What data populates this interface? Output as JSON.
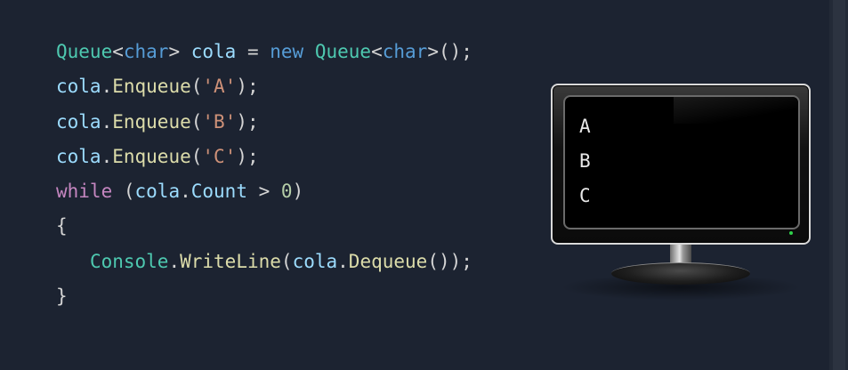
{
  "code_lines": [
    [
      {
        "text": "Queue",
        "kind": "type"
      },
      {
        "text": "<",
        "kind": "op"
      },
      {
        "text": "char",
        "kind": "kw"
      },
      {
        "text": "> ",
        "kind": "op"
      },
      {
        "text": "cola",
        "kind": "var"
      },
      {
        "text": " = ",
        "kind": "op"
      },
      {
        "text": "new",
        "kind": "kw"
      },
      {
        "text": " ",
        "kind": "op"
      },
      {
        "text": "Queue",
        "kind": "type"
      },
      {
        "text": "<",
        "kind": "op"
      },
      {
        "text": "char",
        "kind": "kw"
      },
      {
        "text": ">();",
        "kind": "op"
      }
    ],
    [
      {
        "text": "cola",
        "kind": "var"
      },
      {
        "text": ".",
        "kind": "op"
      },
      {
        "text": "Enqueue",
        "kind": "fn"
      },
      {
        "text": "(",
        "kind": "op"
      },
      {
        "text": "'A'",
        "kind": "str"
      },
      {
        "text": ");",
        "kind": "op"
      }
    ],
    [
      {
        "text": "cola",
        "kind": "var"
      },
      {
        "text": ".",
        "kind": "op"
      },
      {
        "text": "Enqueue",
        "kind": "fn"
      },
      {
        "text": "(",
        "kind": "op"
      },
      {
        "text": "'B'",
        "kind": "str"
      },
      {
        "text": ");",
        "kind": "op"
      }
    ],
    [
      {
        "text": "cola",
        "kind": "var"
      },
      {
        "text": ".",
        "kind": "op"
      },
      {
        "text": "Enqueue",
        "kind": "fn"
      },
      {
        "text": "(",
        "kind": "op"
      },
      {
        "text": "'C'",
        "kind": "str"
      },
      {
        "text": ");",
        "kind": "op"
      }
    ],
    [
      {
        "text": "while",
        "kind": "ctrl"
      },
      {
        "text": " (",
        "kind": "op"
      },
      {
        "text": "cola",
        "kind": "var"
      },
      {
        "text": ".",
        "kind": "op"
      },
      {
        "text": "Count",
        "kind": "var"
      },
      {
        "text": " > ",
        "kind": "op"
      },
      {
        "text": "0",
        "kind": "num"
      },
      {
        "text": ")",
        "kind": "op"
      }
    ],
    [
      {
        "text": "{",
        "kind": "op"
      }
    ],
    [
      {
        "text": "   ",
        "kind": "op"
      },
      {
        "text": "Console",
        "kind": "type"
      },
      {
        "text": ".",
        "kind": "op"
      },
      {
        "text": "WriteLine",
        "kind": "fn"
      },
      {
        "text": "(",
        "kind": "op"
      },
      {
        "text": "cola",
        "kind": "var"
      },
      {
        "text": ".",
        "kind": "op"
      },
      {
        "text": "Dequeue",
        "kind": "fn"
      },
      {
        "text": "());",
        "kind": "op"
      }
    ],
    [
      {
        "text": "}",
        "kind": "op"
      }
    ]
  ],
  "console_output": [
    "A",
    "B",
    "C"
  ],
  "colors": {
    "background": "#1c2331",
    "type": "#4ec9b0",
    "keyword": "#569cd6",
    "control": "#c586c0",
    "variable": "#9cdcfe",
    "function": "#dcdcaa",
    "string": "#ce9178",
    "number": "#b5cea8"
  },
  "icons": {
    "monitor": "monitor-icon",
    "power_led": "power-led-icon"
  }
}
